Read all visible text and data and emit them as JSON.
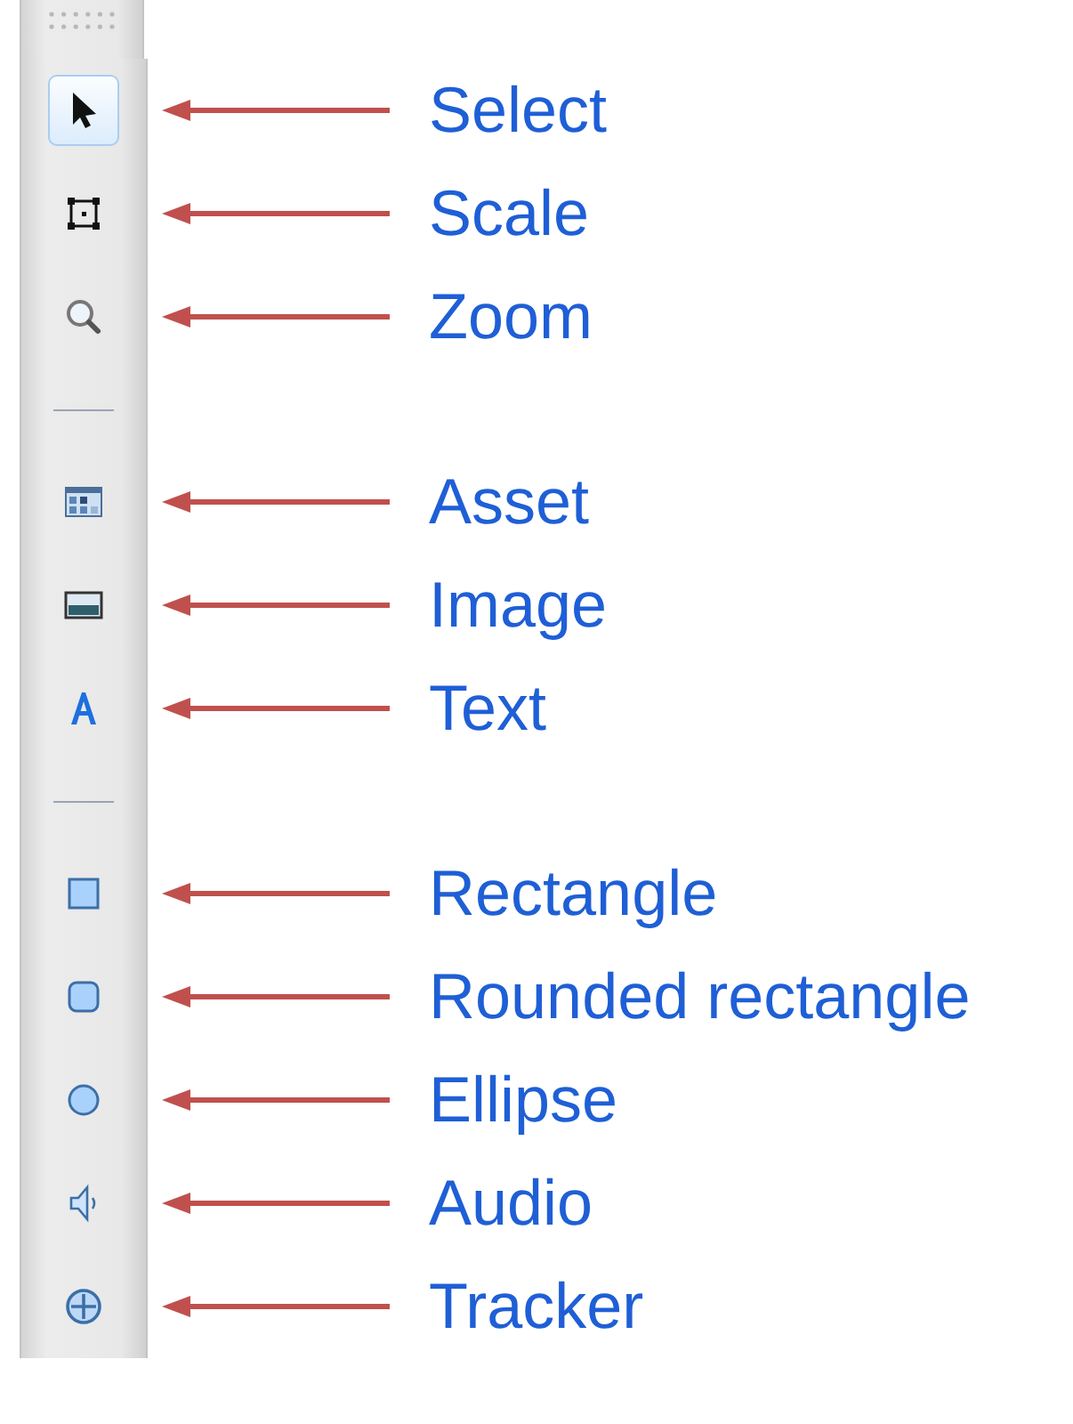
{
  "toolbar": {
    "groups": [
      [
        {
          "callout": "Select",
          "selected": true
        },
        {
          "callout": "Scale",
          "selected": false
        },
        {
          "callout": "Zoom",
          "selected": false
        }
      ],
      [
        {
          "callout": "Asset",
          "selected": false
        },
        {
          "callout": "Image",
          "selected": false
        },
        {
          "callout": "Text",
          "selected": false
        }
      ],
      [
        {
          "callout": "Rectangle",
          "selected": false
        },
        {
          "callout": "Rounded rectangle",
          "selected": false
        },
        {
          "callout": "Ellipse",
          "selected": false
        },
        {
          "callout": "Audio",
          "selected": false
        },
        {
          "callout": "Tracker",
          "selected": false
        }
      ]
    ]
  }
}
